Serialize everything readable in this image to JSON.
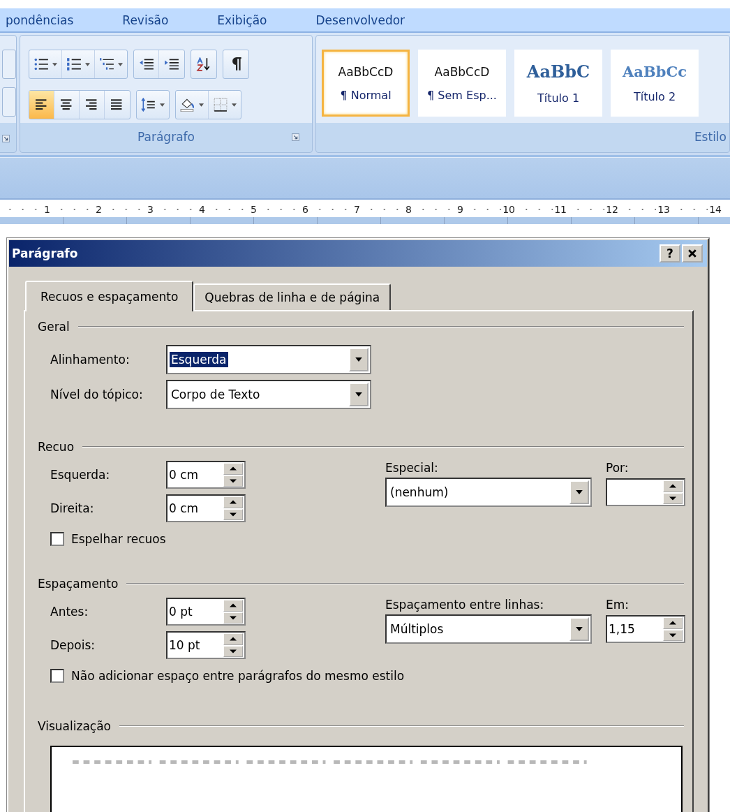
{
  "ribbon": {
    "tabs": [
      "pondências",
      "Revisão",
      "Exibição",
      "Desenvolvedor"
    ],
    "paragraph_group": {
      "label": "Parágrafo",
      "alignment_buttons": [
        {
          "kind": "left",
          "selected": true
        },
        {
          "kind": "center",
          "selected": false
        },
        {
          "kind": "right",
          "selected": false
        },
        {
          "kind": "justify",
          "selected": false
        }
      ]
    },
    "styles_group": {
      "label": "Estilo",
      "styles": [
        {
          "preview": "AaBbCcD",
          "name": "¶ Normal",
          "kind": "body",
          "selected": true
        },
        {
          "preview": "AaBbCcD",
          "name": "¶ Sem Esp...",
          "kind": "body",
          "selected": false
        },
        {
          "preview": "AaBbC",
          "name": "Título 1",
          "kind": "heading1",
          "selected": false
        },
        {
          "preview": "AaBbCc",
          "name": "Título 2",
          "kind": "heading2",
          "selected": false
        }
      ]
    }
  },
  "ruler": {
    "labels": [
      "1",
      "2",
      "3",
      "4",
      "5",
      "6",
      "7",
      "8",
      "9",
      "10",
      "11",
      "12",
      "13",
      "14"
    ]
  },
  "dialog": {
    "title": "Parágrafo",
    "help_button": "?",
    "tabs": [
      {
        "label": "Recuos e espaçamento",
        "selected": true
      },
      {
        "label": "Quebras de linha e de página",
        "selected": false
      }
    ],
    "general": {
      "heading": "Geral",
      "alignment": {
        "label": "Alinhamento:",
        "value": "Esquerda",
        "focused": true
      },
      "outline_level": {
        "label": "Nível do tópico:",
        "value": "Corpo de Texto",
        "focused": false
      }
    },
    "indent": {
      "heading": "Recuo",
      "left": {
        "label": "Esquerda:",
        "value": "0 cm"
      },
      "right": {
        "label": "Direita:",
        "value": "0 cm"
      },
      "special": {
        "label": "Especial:",
        "value": "(nenhum)"
      },
      "by": {
        "label": "Por:"
      },
      "mirror": {
        "label": "Espelhar recuos",
        "checked": false
      }
    },
    "spacing": {
      "heading": "Espaçamento",
      "before": {
        "label": "Antes:",
        "value": "0 pt"
      },
      "after": {
        "label": "Depois:",
        "value": "10 pt"
      },
      "line_spacing": {
        "label": "Espaçamento entre linhas:",
        "value": "Múltiplos"
      },
      "at": {
        "label": "Em:",
        "value": "1,15"
      },
      "no_space": {
        "label": "Não adicionar espaço entre parágrafos do mesmo estilo",
        "checked": false
      }
    },
    "preview": {
      "heading": "Visualização"
    }
  }
}
